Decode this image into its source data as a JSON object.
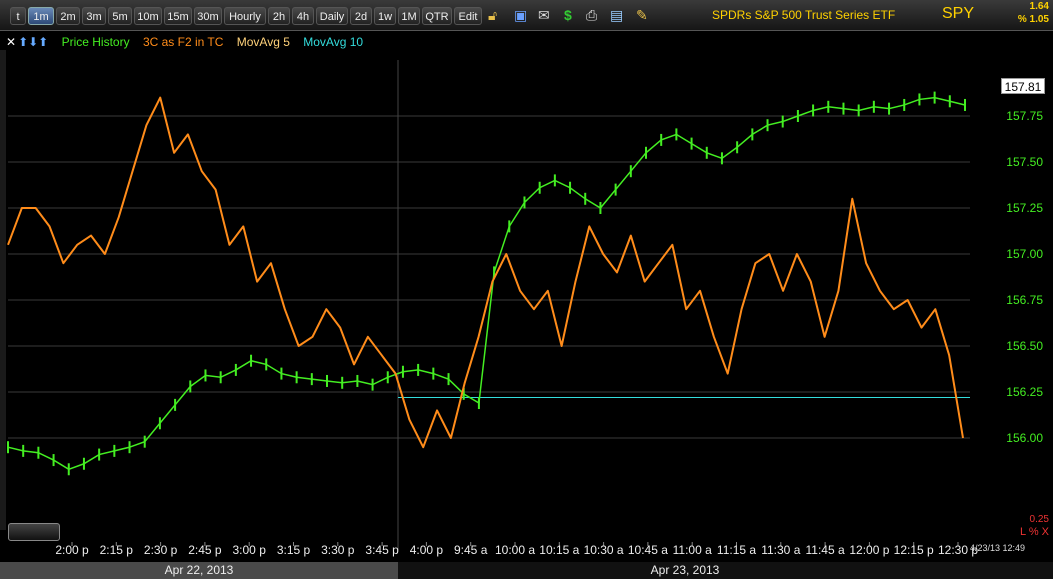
{
  "toolbar": {
    "buttons": [
      "t",
      "1m",
      "2m",
      "3m",
      "5m",
      "10m",
      "15m",
      "30m",
      "Hourly",
      "2h",
      "4h",
      "Daily",
      "2d",
      "1w",
      "1M",
      "QTR",
      "Edit"
    ],
    "active": "1m",
    "icons": [
      "lock-icon",
      "save-icon",
      "email-icon",
      "dollar-icon",
      "print-icon",
      "news-icon",
      "pencil-icon"
    ]
  },
  "header": {
    "title": "SPDRs S&P 500 Trust Series ETF",
    "symbol": "SPY",
    "change_pct": "1.64",
    "change_pct2": "% 1.05"
  },
  "legend": {
    "price_history": "Price History",
    "indicator": "3C as F2 in TC",
    "ma5": "MovAvg 5",
    "ma10": "MovAvg 10"
  },
  "colors": {
    "price": "#44ee22",
    "indicator": "#ff8c1a",
    "ma5": "#ffd27a",
    "ma10": "#33dddd",
    "grid": "#3a3a3a"
  },
  "dates": {
    "day1": "Apr 22, 2013",
    "day2": "Apr 23, 2013"
  },
  "timestamp": "4/23/13 12:49",
  "lower_scale": "0.25",
  "lower_legend": "L % X",
  "price_tag": "157.81",
  "chart_data": {
    "type": "line",
    "ylim": [
      155.5,
      158.0
    ],
    "y_ticks": [
      "157.75",
      "157.50",
      "157.25",
      "157.00",
      "156.75",
      "156.50",
      "156.25",
      "156.00"
    ],
    "x_ticks": [
      "2:00 p",
      "2:15 p",
      "2:30 p",
      "2:45 p",
      "3:00 p",
      "3:15 p",
      "3:30 p",
      "3:45 p",
      "4:00 p",
      "9:45 a",
      "10:00 a",
      "10:15 a",
      "10:30 a",
      "10:45 a",
      "11:00 a",
      "11:15 a",
      "11:30 a",
      "11:45 a",
      "12:00 p",
      "12:15 p",
      "12:30 p"
    ],
    "series": [
      {
        "name": "Price History",
        "values": [
          155.95,
          155.93,
          155.92,
          155.88,
          155.83,
          155.86,
          155.91,
          155.93,
          155.95,
          155.98,
          156.08,
          156.18,
          156.28,
          156.34,
          156.33,
          156.37,
          156.42,
          156.4,
          156.35,
          156.33,
          156.32,
          156.31,
          156.3,
          156.31,
          156.29,
          156.33,
          156.36,
          156.37,
          156.35,
          156.32,
          156.24,
          156.19,
          156.9,
          157.15,
          157.28,
          157.36,
          157.4,
          157.36,
          157.3,
          157.25,
          157.35,
          157.45,
          157.55,
          157.62,
          157.65,
          157.6,
          157.55,
          157.52,
          157.58,
          157.65,
          157.7,
          157.72,
          157.75,
          157.78,
          157.8,
          157.79,
          157.78,
          157.8,
          157.79,
          157.81,
          157.84,
          157.85,
          157.83,
          157.81
        ]
      },
      {
        "name": "3C as F2 in TC",
        "values": [
          157.05,
          157.25,
          157.25,
          157.15,
          156.95,
          157.05,
          157.1,
          157.0,
          157.2,
          157.45,
          157.7,
          157.85,
          157.55,
          157.65,
          157.45,
          157.35,
          157.05,
          157.15,
          156.85,
          156.95,
          156.7,
          156.5,
          156.55,
          156.7,
          156.6,
          156.4,
          156.55,
          156.45,
          156.35,
          156.1,
          155.95,
          156.15,
          156.0,
          156.3,
          156.55,
          156.85,
          157.0,
          156.8,
          156.7,
          156.8,
          156.5,
          156.85,
          157.15,
          157.0,
          156.9,
          157.1,
          156.85,
          156.95,
          157.05,
          156.7,
          156.8,
          156.55,
          156.35,
          156.7,
          156.95,
          157.0,
          156.8,
          157.0,
          156.85,
          156.55,
          156.8,
          157.3,
          156.95,
          156.8,
          156.7,
          156.75,
          156.6,
          156.7,
          156.45,
          156.0
        ]
      },
      {
        "name": "MovAvg 10",
        "values": [
          156.22,
          156.22
        ]
      }
    ]
  }
}
